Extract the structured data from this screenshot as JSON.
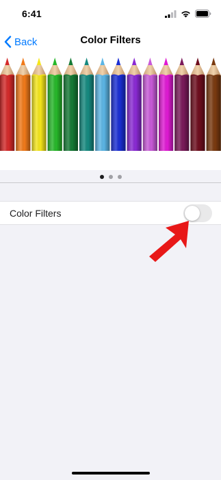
{
  "status_bar": {
    "time": "6:41",
    "icons": [
      "cellular-signal-icon",
      "wifi-icon",
      "battery-icon"
    ]
  },
  "nav": {
    "back_label": "Back",
    "title": "Color Filters"
  },
  "hero": {
    "pencil_colors": [
      "#d42a2a",
      "#f07a1a",
      "#f5e61a",
      "#27b82a",
      "#157a35",
      "#168a80",
      "#5bb5e5",
      "#1a2ed4",
      "#8a2ad4",
      "#c85ad8",
      "#e01ad4",
      "#7a1a5a",
      "#6e0e1e",
      "#7a3a10"
    ],
    "page_count": 3,
    "active_page": 1
  },
  "settings": {
    "color_filters_label": "Color Filters",
    "color_filters_enabled": false
  },
  "colors": {
    "accent": "#007aff",
    "arrow": "#e81818",
    "toggle_off": "#e9e9ea",
    "background": "#f2f2f7"
  }
}
